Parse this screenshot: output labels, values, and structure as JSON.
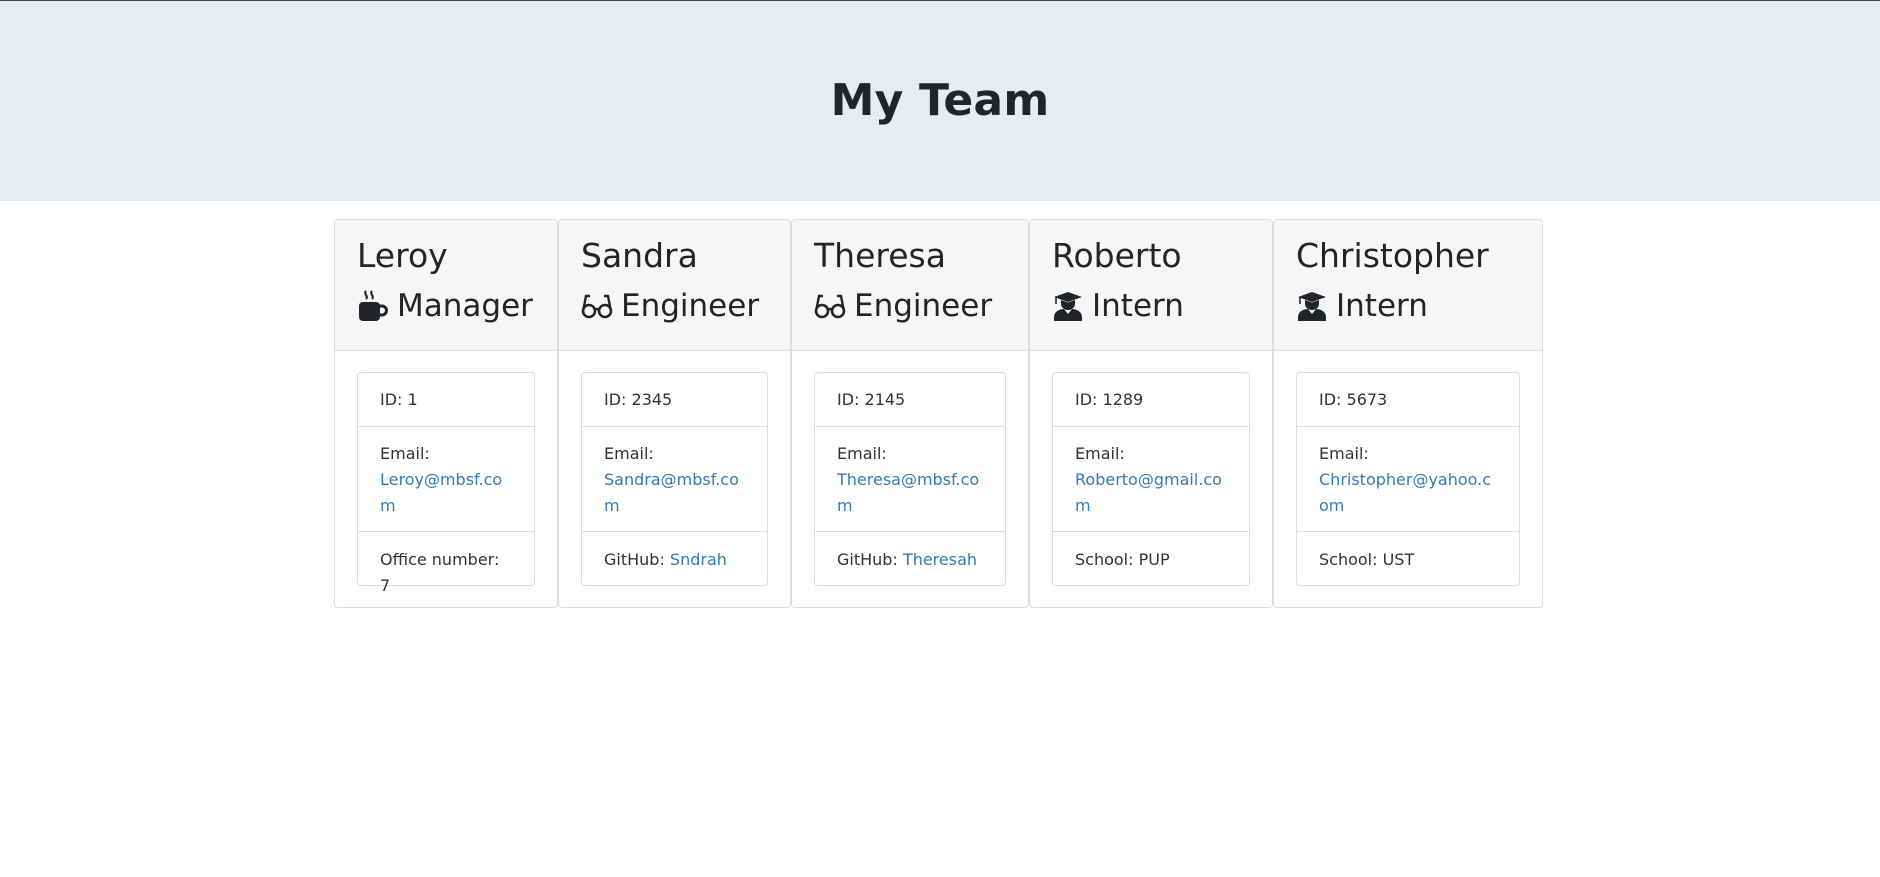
{
  "header": {
    "title": "My Team"
  },
  "labels": {
    "id_prefix": "ID: ",
    "email_label": "Email:",
    "office_prefix": "Office number: ",
    "github_prefix": "GitHub: ",
    "school_prefix": "School: "
  },
  "employees": [
    {
      "name": "Leroy",
      "role": "Manager",
      "icon": "mug-icon",
      "id": "1",
      "email": "Leroy@mbsf.com",
      "extra_value": "7"
    },
    {
      "name": "Sandra",
      "role": "Engineer",
      "icon": "glasses-icon",
      "id": "2345",
      "email": "Sandra@mbsf.com",
      "extra_value": "Sndrah"
    },
    {
      "name": "Theresa",
      "role": "Engineer",
      "icon": "glasses-icon",
      "id": "2145",
      "email": "Theresa@mbsf.com",
      "extra_value": "Theresah"
    },
    {
      "name": "Roberto",
      "role": "Intern",
      "icon": "graduate-icon",
      "id": "1289",
      "email": "Roberto@gmail.com",
      "extra_value": "PUP"
    },
    {
      "name": "Christopher",
      "role": "Intern",
      "icon": "graduate-icon",
      "id": "5673",
      "email": "Christopher@yahoo.com",
      "extra_value": "UST"
    }
  ]
}
